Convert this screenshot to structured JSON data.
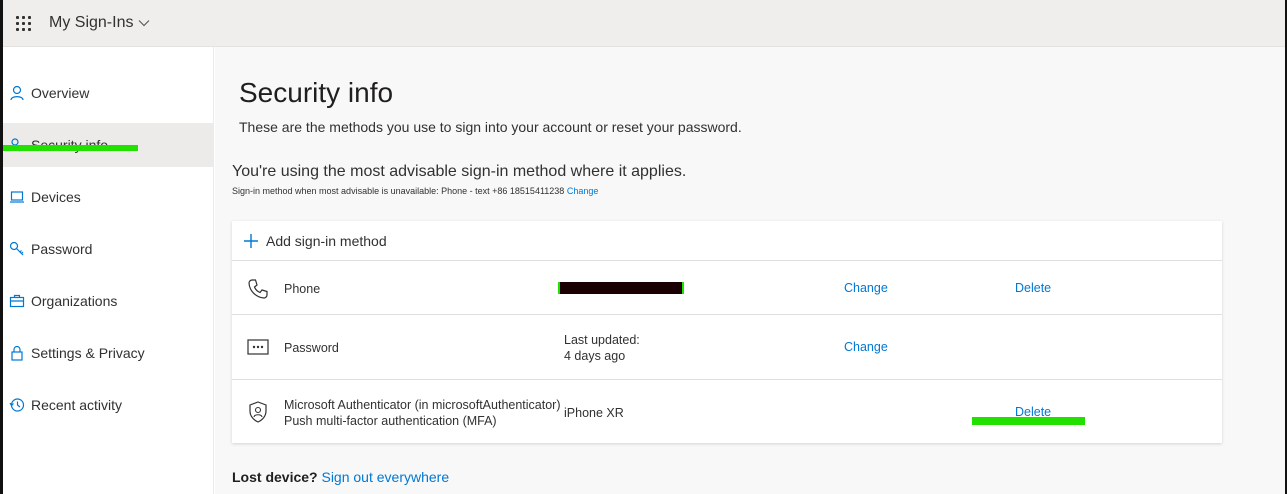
{
  "app": {
    "title": "My Sign-Ins"
  },
  "sidebar": {
    "items": [
      {
        "label": "Overview",
        "icon": "person-icon"
      },
      {
        "label": "Security info",
        "icon": "key-person-icon",
        "active": true
      },
      {
        "label": "Devices",
        "icon": "laptop-icon"
      },
      {
        "label": "Password",
        "icon": "key-icon"
      },
      {
        "label": "Organizations",
        "icon": "briefcase-icon"
      },
      {
        "label": "Settings & Privacy",
        "icon": "lock-icon"
      },
      {
        "label": "Recent activity",
        "icon": "history-icon"
      }
    ]
  },
  "main": {
    "title": "Security info",
    "subtitle": "These are the methods you use to sign into your account or reset your password.",
    "advisable": "You're using the most advisable sign-in method where it applies.",
    "fallback_text": "Sign-in method when most advisable is unavailable: Phone - text +86 18515411238",
    "fallback_change": "Change",
    "add_method": "Add sign-in method",
    "methods": [
      {
        "name": "Phone",
        "icon": "phone-icon",
        "detail": "",
        "change": "Change",
        "delete": "Delete"
      },
      {
        "name": "Password",
        "icon": "password-dots-icon",
        "detail_line1": "Last updated:",
        "detail_line2": "4 days ago",
        "change": "Change",
        "delete": ""
      },
      {
        "name_line1": "Microsoft Authenticator (in microsoftAuthenticator)",
        "name_line2": "Push multi-factor authentication (MFA)",
        "icon": "authenticator-icon",
        "detail": "iPhone XR",
        "change": "",
        "delete": "Delete"
      }
    ],
    "lost_device_label": "Lost device?",
    "sign_out_everywhere": "Sign out everywhere"
  },
  "colors": {
    "link": "#0078d4",
    "highlight": "#22e000",
    "active_nav_bg": "#edebe9"
  }
}
